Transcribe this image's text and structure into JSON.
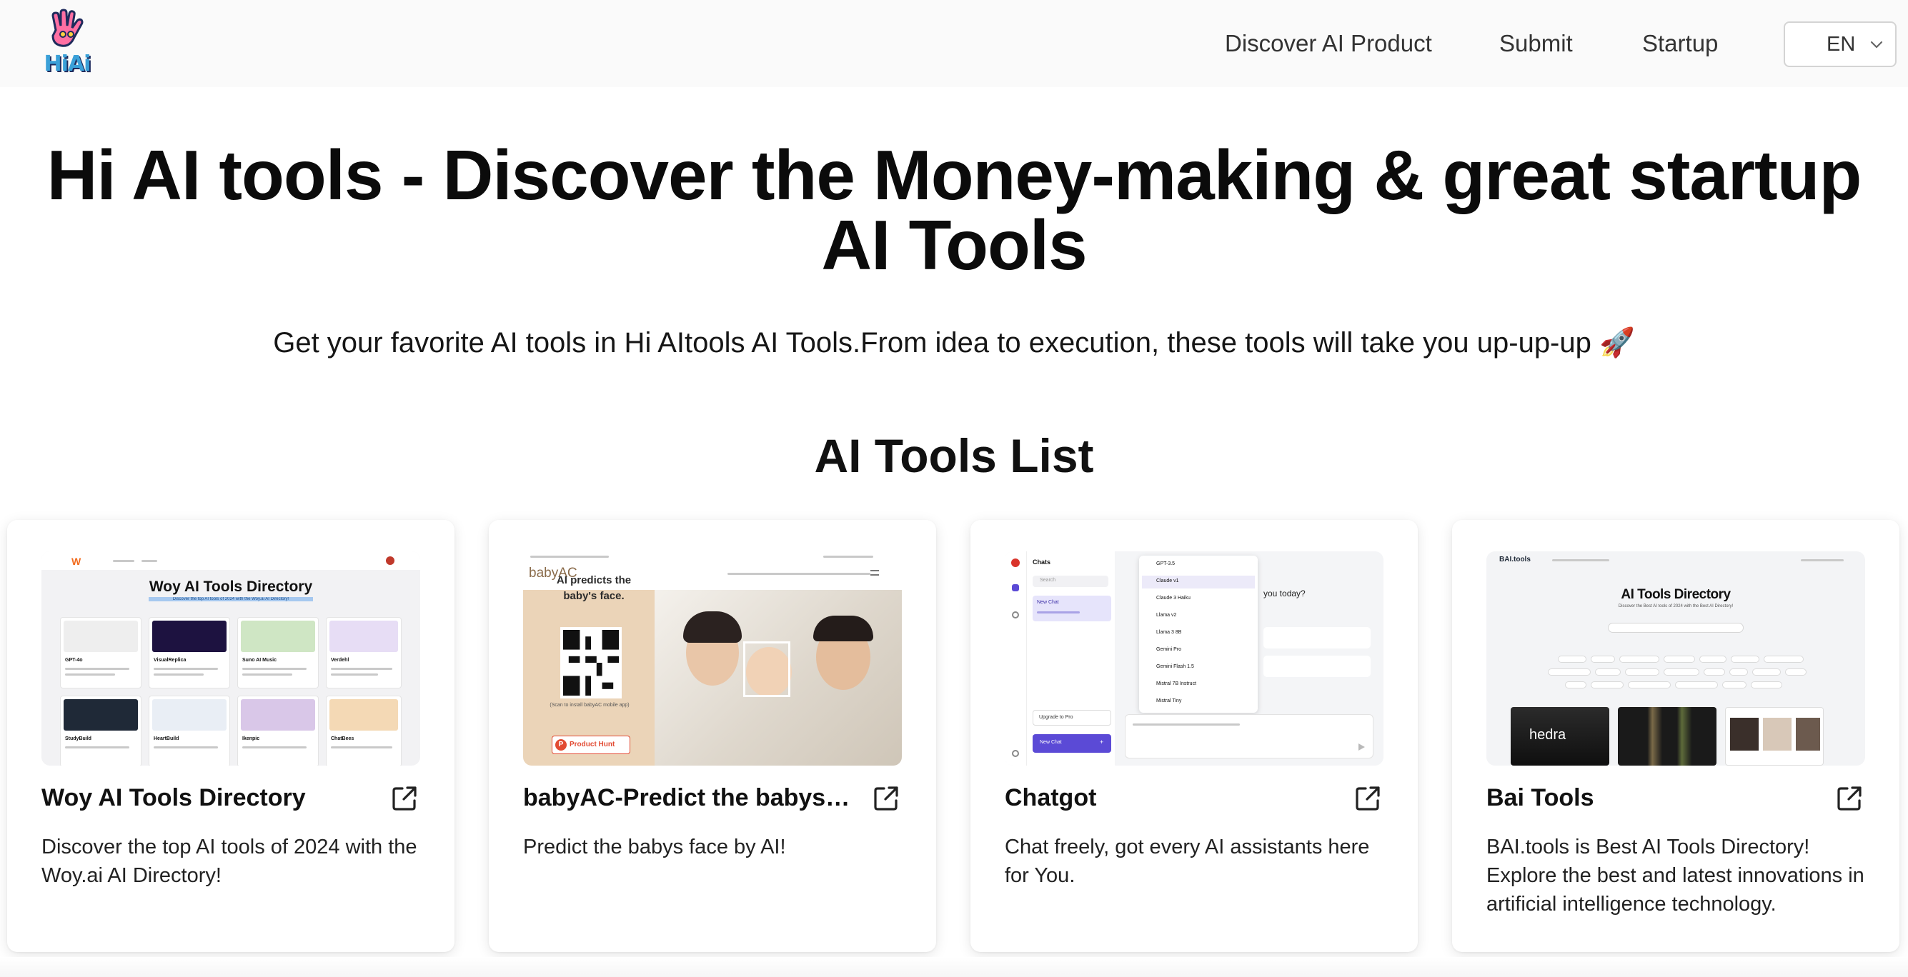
{
  "header": {
    "logo_text": "HiAi",
    "nav": {
      "discover": "Discover AI Product",
      "submit": "Submit",
      "startup": "Startup"
    },
    "language": "EN"
  },
  "hero": {
    "title": "Hi AI tools - Discover the Money-making & great startup AI Tools",
    "subtitle": "Get your favorite AI tools in Hi AItools AI Tools.From idea to execution, these tools will take you up-up-up 🚀"
  },
  "section_title": "AI Tools List",
  "cards": [
    {
      "title": "Woy AI Tools Directory",
      "description": "Discover the top AI tools of 2024 with the Woy.ai AI Directory!",
      "thumb_heading": "Woy AI Tools Directory",
      "thumb_sub": "Discover the top AI tools of 2024 with the Woy.ai AI Directory!",
      "thumb_items": [
        "GPT-4o",
        "VisualReplica",
        "Suno AI Music",
        "Verdehl",
        "StudyBuild",
        "HeartBuild",
        "Ikenpic",
        "ChatBees"
      ]
    },
    {
      "title": "babyAC-Predict the babys face by AI!",
      "description": "Predict the babys face by AI!",
      "thumb_logo": "babyAC",
      "thumb_heading": "AI predicts the baby's face.",
      "thumb_caption": "(Scan to install babyAC mobile app)",
      "thumb_badge": "Product Hunt"
    },
    {
      "title": "Chatgot",
      "description": "Chat freely, got every AI assistants here for You.",
      "thumb_panel": "Chats",
      "thumb_search": "Search",
      "thumb_new_chat": "New Chat",
      "thumb_upgrade": "Upgrade to Pro",
      "thumb_models": [
        "GPT-3.5",
        "Claude v1",
        "Claude 3 Haiku",
        "Llama v2",
        "Llama 3 8B",
        "Gemini Pro",
        "Gemini Flash 1.5",
        "Mistral 7B Instruct",
        "Mistral Tiny"
      ],
      "thumb_greeting": "you today?"
    },
    {
      "title": "Bai Tools",
      "description": "BAI.tools is Best AI Tools Directory! Explore the best and latest innovations in artificial intelligence technology.",
      "thumb_logo": "BAI.tools",
      "thumb_heading": "AI Tools Directory",
      "thumb_sub": "Discover the Best AI tools of 2024 with the Best AI Directory!",
      "thumb_feature": "hedra"
    }
  ],
  "colors": {
    "accent": "#3aa0d8",
    "card_shadow": "#e5e7eb",
    "woy_brand": "#f26b1d",
    "babyac_bg": "#ebd4b8",
    "chat_accent": "#5b4ad6"
  }
}
